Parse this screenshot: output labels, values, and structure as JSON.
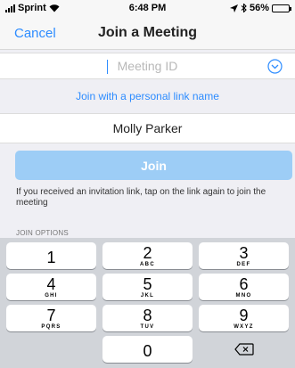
{
  "status_bar": {
    "carrier": "Sprint",
    "time": "6:48 PM",
    "battery_text": "56%",
    "battery_level": 0.56,
    "icons": [
      "signal-bars-icon",
      "wifi-icon",
      "location-arrow-icon",
      "bluetooth-icon",
      "battery-icon"
    ]
  },
  "nav": {
    "cancel_label": "Cancel",
    "title": "Join a Meeting"
  },
  "meeting_id": {
    "value": "",
    "placeholder": "Meeting ID",
    "dropdown_icon": "chevron-down-circle-icon"
  },
  "personal_link_label": "Join with a personal link name",
  "name_field": {
    "value": "Molly Parker"
  },
  "join_label": "Join",
  "hint_text": "If you received an invitation link, tap on the link again to join the meeting",
  "join_options_label": "JOIN OPTIONS",
  "keypad": {
    "keys": [
      {
        "digit": "1",
        "letters": ""
      },
      {
        "digit": "2",
        "letters": "ABC"
      },
      {
        "digit": "3",
        "letters": "DEF"
      },
      {
        "digit": "4",
        "letters": "GHI"
      },
      {
        "digit": "5",
        "letters": "JKL"
      },
      {
        "digit": "6",
        "letters": "MNO"
      },
      {
        "digit": "7",
        "letters": "PQRS"
      },
      {
        "digit": "8",
        "letters": "TUV"
      },
      {
        "digit": "9",
        "letters": "WXYZ"
      },
      {
        "digit": "0",
        "letters": ""
      }
    ],
    "delete_icon": "backspace-icon"
  },
  "colors": {
    "accent": "#2d8cff",
    "join_button_disabled": "#9dcdf6",
    "background": "#efeff4",
    "keypad_background": "#d1d4d9"
  }
}
